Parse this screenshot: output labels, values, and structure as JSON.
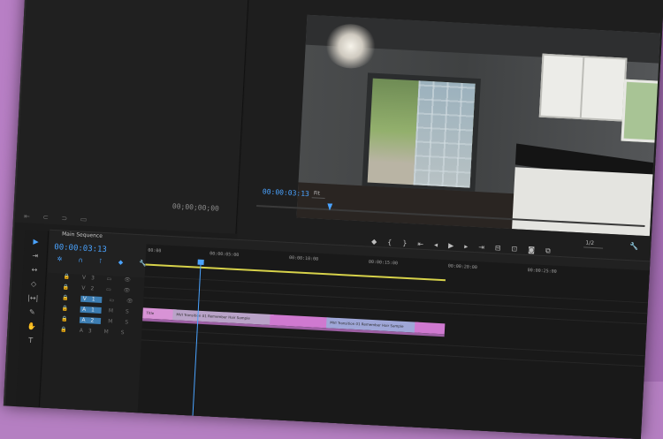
{
  "source_monitor": {
    "timecode": "00;00;00;00",
    "control_icons": "⇤ ⊂ ⊃ ▭"
  },
  "program_monitor": {
    "timecode": "00:00:03:13",
    "fit_label": "Fit",
    "ratio_label": "1/2",
    "transport_icons": [
      "◆",
      "{",
      "}",
      "⇤",
      "◂",
      "▶",
      "▸",
      "⇥",
      "⊟",
      "⊡",
      "◙",
      "⧉"
    ],
    "wrench": "🔧"
  },
  "tools": [
    "▶",
    "⇥",
    "↔",
    "◇",
    "|↔|",
    "✎",
    "✋",
    "T"
  ],
  "sequence": {
    "title": "Main Sequence",
    "timecode": "00:00:03:13",
    "buttons": "✲ ∩ ⊺ ◆ 🔧",
    "track_rows": [
      {
        "label": "V3"
      },
      {
        "label": "V2"
      },
      {
        "label": "V1"
      },
      {
        "label": "A1"
      },
      {
        "label": "A2"
      },
      {
        "label": "A3"
      }
    ],
    "ruler_ticks": [
      "00:00",
      "00:00:05:00",
      "00:00:10:00",
      "00:00:15:00",
      "00:00:20:00",
      "00:00:25:00"
    ],
    "clips": [
      "Title",
      "MVI Transition 01 Remember Hair Sample",
      "MVI Transition 01 Remember Hair Sample"
    ]
  },
  "colors": {
    "accent": "#4aa3ff",
    "work_area": "#d7d24a",
    "clip_pink": "#cf79d0",
    "clip_blue": "#9fa7d8",
    "background": "#b57fc2"
  }
}
